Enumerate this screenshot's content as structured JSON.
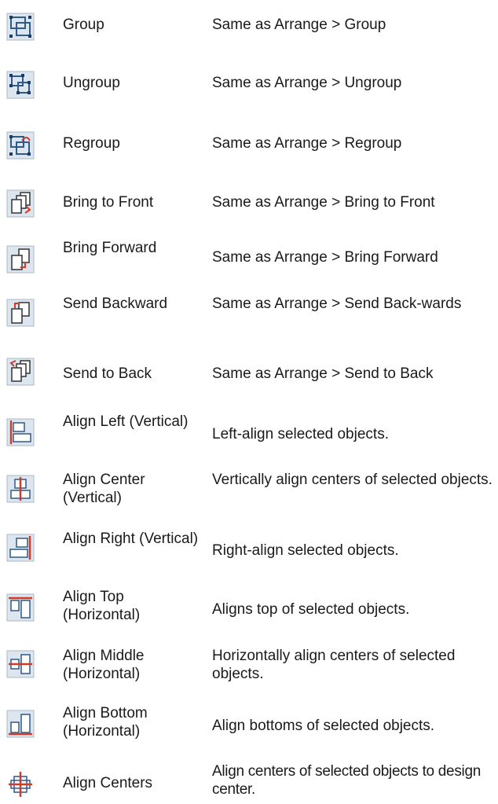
{
  "commands": [
    {
      "icon": "group-icon",
      "name": "Group",
      "description": "Same as Arrange > Group"
    },
    {
      "icon": "ungroup-icon",
      "name": "Ungroup",
      "description": "Same as Arrange > Ungroup"
    },
    {
      "icon": "regroup-icon",
      "name": "Regroup",
      "description": "Same as Arrange > Regroup"
    },
    {
      "icon": "bring-to-front-icon",
      "name": "Bring to Front",
      "description": "Same as Arrange > Bring to Front"
    },
    {
      "icon": "bring-forward-icon",
      "name": "Bring Forward",
      "description": "Same as Arrange > Bring Forward"
    },
    {
      "icon": "send-backward-icon",
      "name": "Send Backward",
      "description": "Same as Arrange > Send Back-wards"
    },
    {
      "icon": "send-to-back-icon",
      "name": "Send to Back",
      "description": "Same as Arrange > Send to Back"
    },
    {
      "icon": "align-left-vertical-icon",
      "name": "Align Left (Vertical)",
      "description": "Left-align selected objects."
    },
    {
      "icon": "align-center-vertical-icon",
      "name": "Align Center (Vertical)",
      "description": "Vertically align centers of selected objects."
    },
    {
      "icon": "align-right-vertical-icon",
      "name": "Align Right (Vertical)",
      "description": "Right-align selected objects."
    },
    {
      "icon": "align-top-horizontal-icon",
      "name": "Align Top (Horizontal)",
      "description": "Aligns top of selected objects."
    },
    {
      "icon": "align-middle-horizontal-icon",
      "name": "Align Middle (Horizontal)",
      "description": "Horizontally align centers of selected objects."
    },
    {
      "icon": "align-bottom-horizontal-icon",
      "name": "Align Bottom (Horizontal)",
      "description": "Align bottoms of selected objects."
    },
    {
      "icon": "align-centers-icon",
      "name": "Align Centers",
      "description": "Align centers of selected objects to design center."
    }
  ],
  "colors": {
    "icon_bg": "#dde6ef",
    "icon_border": "#3a5f8a",
    "accent": "#d23a2a",
    "text": "#1a1a1a"
  }
}
